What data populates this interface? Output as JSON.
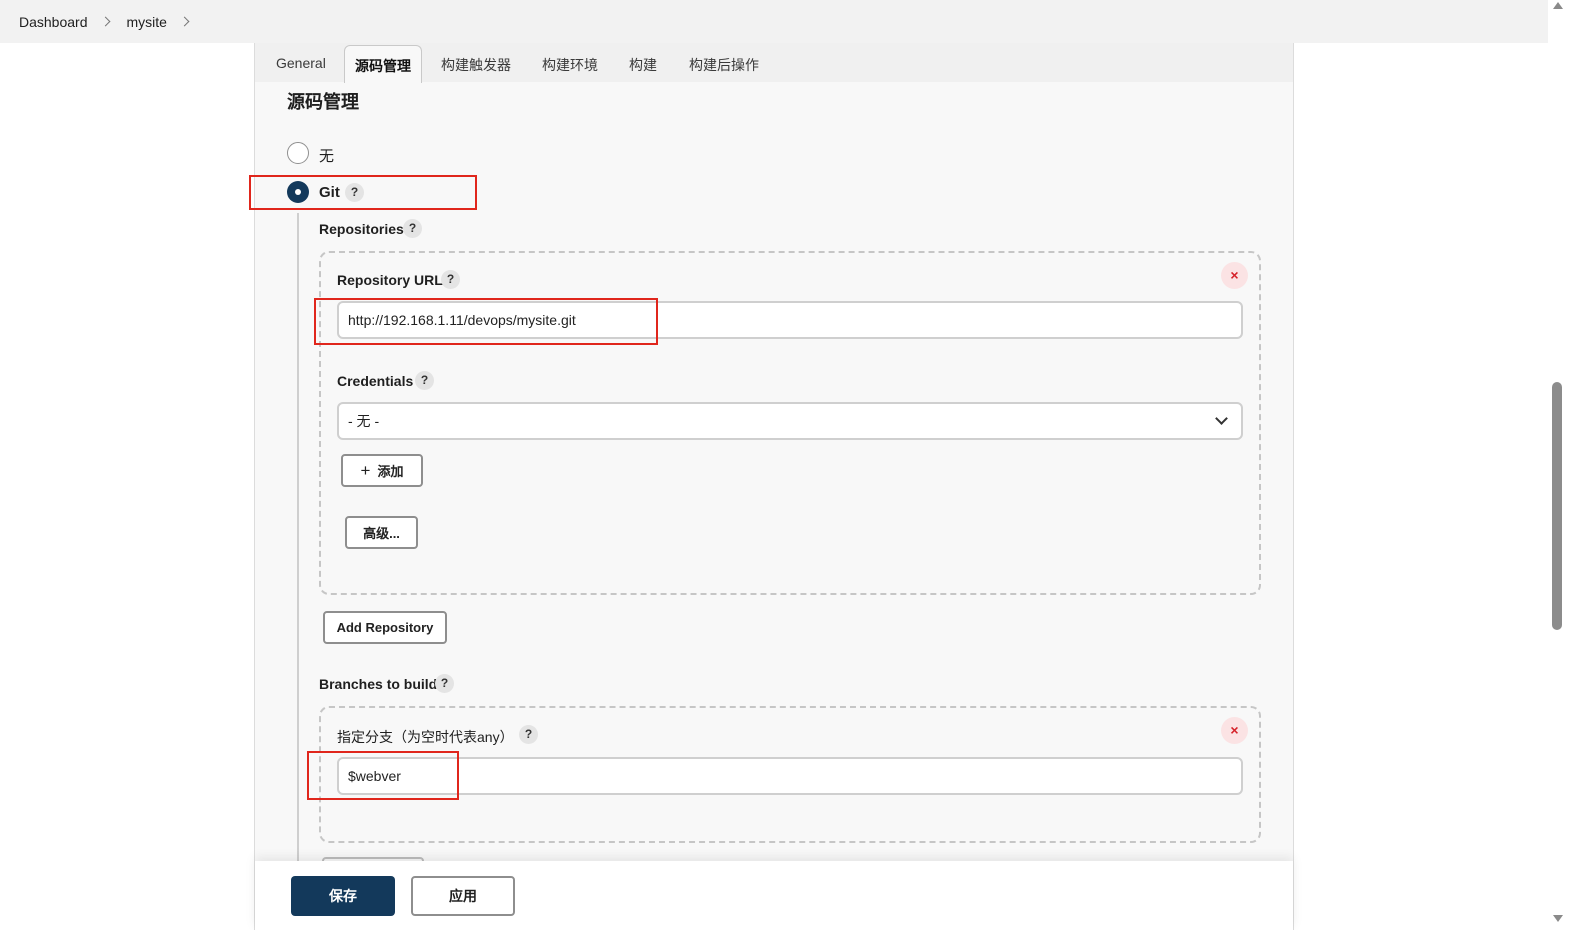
{
  "breadcrumb": {
    "items": [
      "Dashboard",
      "mysite"
    ]
  },
  "tabs": [
    "General",
    "源码管理",
    "构建触发器",
    "构建环境",
    "构建",
    "构建后操作"
  ],
  "active_tab": "源码管理",
  "section_title": "源码管理",
  "scm_options": {
    "none_label": "无",
    "git_label": "Git",
    "selected": "Git"
  },
  "help_glyph": "?",
  "close_glyph": "×",
  "repositories": {
    "label": "Repositories",
    "url_label": "Repository URL",
    "url_value": "http://192.168.1.11/devops/mysite.git",
    "credentials_label": "Credentials",
    "credentials_value": "- 无 -",
    "add_label": "添加",
    "advanced_label": "高级...",
    "add_repository_label": "Add Repository"
  },
  "branches": {
    "label": "Branches to build",
    "specifier_label": "指定分支（为空时代表any）",
    "specifier_value": "$webver"
  },
  "footer": {
    "save_label": "保存",
    "apply_label": "应用"
  },
  "colors": {
    "primary": "#13395b",
    "highlight": "#e0261c",
    "danger": "#d5222a"
  }
}
